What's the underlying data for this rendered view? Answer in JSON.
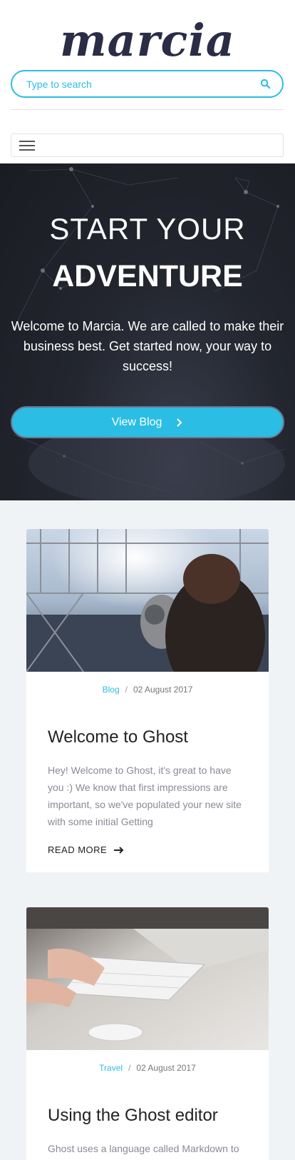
{
  "header": {
    "logo": "marcia",
    "search_placeholder": "Type to search"
  },
  "hero": {
    "line1": "START YOUR",
    "line2": "ADVENTURE",
    "text": "Welcome to Marcia. We are called to make their business best. Get started now, your way to success!",
    "button_label": "View Blog",
    "button_icon": "chevron-right-icon"
  },
  "posts": [
    {
      "category": "Blog",
      "separator": "/",
      "date": "02 August 2017",
      "title": "Welcome to Ghost",
      "excerpt": "Hey! Welcome to Ghost, it's great to have you :) We know that first impressions are important, so we've populated your new site with some initial Getting",
      "read_more": "READ MORE"
    },
    {
      "category": "Travel",
      "separator": "/",
      "date": "02 August 2017",
      "title": "Using the Ghost editor",
      "excerpt": "Ghost uses a language called Markdown to"
    }
  ],
  "colors": {
    "accent": "#2bbde3",
    "logo": "#2a2d45",
    "hero_bg": "#23262f",
    "content_bg": "#f0f3f6"
  }
}
